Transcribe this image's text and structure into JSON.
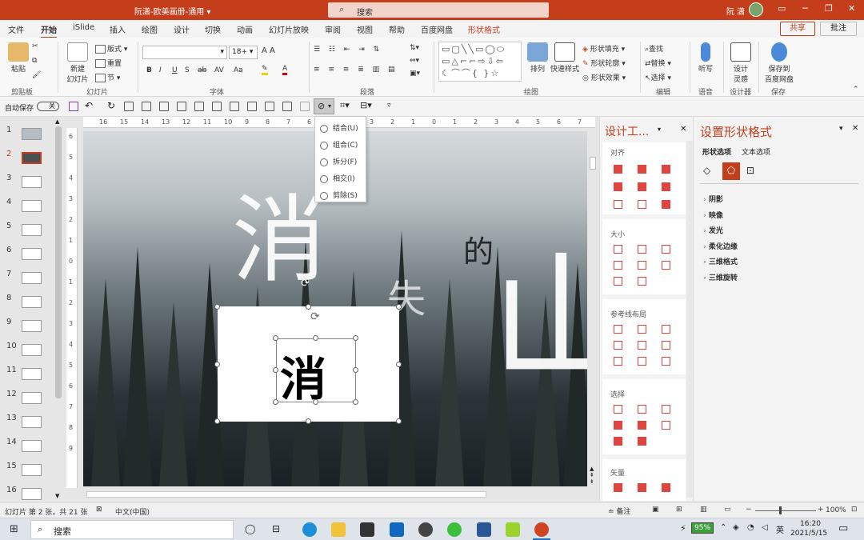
{
  "window": {
    "title": "阮潇-欧美画册-通用 ▾",
    "search_placeholder": "搜索",
    "user": "阮 潇"
  },
  "tabs": [
    "文件",
    "开始",
    "iSlide",
    "插入",
    "绘图",
    "设计",
    "切换",
    "动画",
    "幻灯片放映",
    "审阅",
    "视图",
    "帮助",
    "百度网盘",
    "形状格式"
  ],
  "active_tab": "开始",
  "context_tab": "形状格式",
  "share_label": "共享",
  "comment_label": "批注",
  "ribbon": {
    "groups": [
      "剪贴板",
      "幻灯片",
      "字体",
      "段落",
      "绘图",
      "编辑",
      "语音",
      "设计器",
      "保存"
    ],
    "paste": "粘贴",
    "new_slide": "新建\n幻灯片",
    "layout": "版式",
    "reset": "重置",
    "section": "节",
    "font_size": "18+",
    "arrange": "排列",
    "quick_styles": "快速样式",
    "shape_fill": "形状填充",
    "shape_outline": "形状轮廓",
    "shape_effects": "形状效果",
    "find": "查找",
    "replace": "替换",
    "select": "选择",
    "dictate": "听写",
    "designer": "设计\n灵感",
    "save_baidu": "保存到\n百度网盘"
  },
  "qat": {
    "autosave_label": "自动保存",
    "autosave_state": "关"
  },
  "merge_menu": [
    "结合(U)",
    "组合(C)",
    "拆分(F)",
    "相交(I)",
    "剪除(S)"
  ],
  "slide_numbers": [
    "1",
    "2",
    "3",
    "4",
    "5",
    "6",
    "7",
    "8",
    "9",
    "10",
    "11",
    "12",
    "13",
    "14",
    "15",
    "16"
  ],
  "active_slide": "2",
  "slide": {
    "chars": [
      "消",
      "的",
      "失",
      "山"
    ],
    "box_char": "消"
  },
  "ruler_h": [
    "16",
    "15",
    "14",
    "13",
    "12",
    "11",
    "10",
    "9",
    "8",
    "7",
    "6",
    "5",
    "4",
    "3",
    "2",
    "1",
    "0",
    "1",
    "2",
    "3",
    "4",
    "5",
    "6",
    "7",
    "8",
    "9"
  ],
  "ruler_v": [
    "6",
    "5",
    "4",
    "3",
    "2",
    "1",
    "0",
    "1",
    "2",
    "3",
    "4",
    "5",
    "6",
    "7",
    "8",
    "9"
  ],
  "design_pane": {
    "title": "设计工...",
    "sections": [
      "对齐",
      "大小",
      "参考线布局",
      "选择",
      "矢量"
    ]
  },
  "format_pane": {
    "title": "设置形状格式",
    "tab1": "形状选项",
    "tab2": "文本选项",
    "sections": [
      "阴影",
      "映像",
      "发光",
      "柔化边缘",
      "三维格式",
      "三维旋转"
    ]
  },
  "status": {
    "slide_info": "幻灯片 第 2 张，共 21 张",
    "language": "中文(中国)",
    "notes": "备注",
    "zoom": "100%"
  },
  "taskbar": {
    "search": "搜索",
    "battery": "95%",
    "ime": "英",
    "time": "16:20",
    "date": "2021/5/15"
  }
}
